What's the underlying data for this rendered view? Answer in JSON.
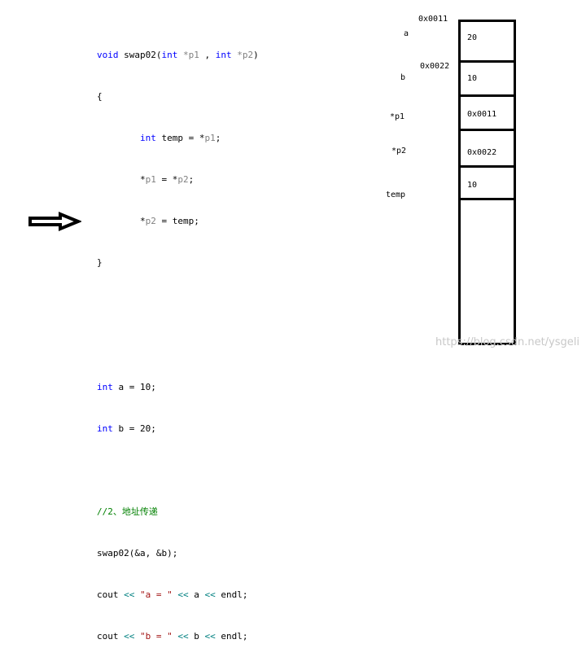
{
  "code": {
    "func_sig": {
      "void": "void",
      "name": " swap02(",
      "int1": "int",
      "p1": " *p1",
      "sep": " , ",
      "int2": "int",
      "p2": " *p2",
      "close": ")"
    },
    "open_brace": "{",
    "line_temp": {
      "indent": "\t",
      "int": "int",
      "rest1": " temp = *",
      "p1": "p1",
      "semi": ";"
    },
    "line_p1": {
      "indent": "\t",
      "star1": "*",
      "p1": "p1",
      "eq": " = *",
      "p2": "p2",
      "semi": ";"
    },
    "line_p2": {
      "indent": "\t",
      "star": "*",
      "p2": "p2",
      "rest": " = temp;"
    },
    "close_brace": "}",
    "line_a": {
      "int": "int",
      "rest": " a = 10;"
    },
    "line_b": {
      "int": "int",
      "rest": " b = 20;"
    },
    "comment": "//2、地址传递",
    "call": "swap02(&a, &b);",
    "cout_a": {
      "cout": "cout ",
      "op1": "<<",
      "str": " \"a = \" ",
      "op2": "<<",
      "mid": " a ",
      "op3": "<<",
      "end": " endl;"
    },
    "cout_b": {
      "cout": "cout ",
      "op1": "<<",
      "str": " \"b = \" ",
      "op2": "<<",
      "mid": " b ",
      "op3": "<<",
      "end": " endl;"
    }
  },
  "memory": {
    "labels": {
      "a": "a",
      "b": "b",
      "p1": "*p1",
      "p2": "*p2",
      "temp": "temp"
    },
    "addresses": {
      "a": "0x0011",
      "b": "0x0022"
    },
    "cells": {
      "a": "20",
      "b": "10",
      "p1": "0x0011",
      "p2": "0x0022",
      "temp": "10"
    }
  },
  "watermark": "https://blog.csdn.net/ysgeli",
  "colors": {
    "keyword": "#0000ff",
    "parameter": "#808080",
    "string": "#a31515",
    "operator": "#008080",
    "comment": "#008000"
  }
}
